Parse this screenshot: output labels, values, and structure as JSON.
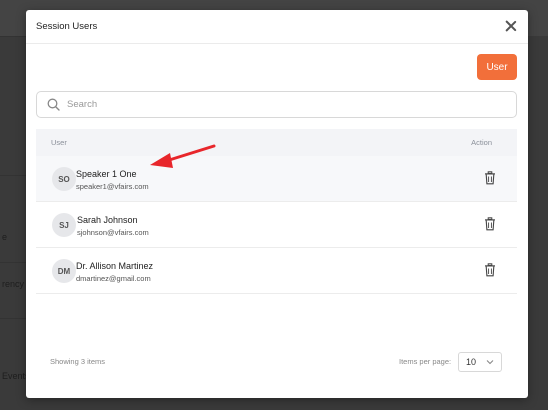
{
  "background": {
    "fragments": [
      "e",
      "rency",
      "Events"
    ]
  },
  "modal": {
    "title": "Session Users",
    "user_button_label": "User",
    "search": {
      "placeholder": "Search",
      "value": ""
    },
    "table": {
      "columns": [
        "User",
        "Action"
      ],
      "rows": [
        {
          "initials": "SO",
          "name": "Speaker 1 One",
          "email": "speaker1@vfairs.com"
        },
        {
          "initials": "SJ",
          "name": "Sarah Johnson",
          "email": "sjohnson@vfairs.com"
        },
        {
          "initials": "DM",
          "name": "Dr. Allison Martinez",
          "email": "dmartinez@gmail.com"
        }
      ]
    },
    "footer": {
      "showing": "Showing 3 items",
      "items_per_page_label": "Items per page:",
      "items_per_page_value": "10"
    }
  },
  "colors": {
    "accent": "#f26f3a",
    "annotation_arrow": "#e8262b"
  },
  "icons": [
    "close-icon",
    "search-icon",
    "trash-icon",
    "chevron-down-icon",
    "arrow-annotation"
  ]
}
